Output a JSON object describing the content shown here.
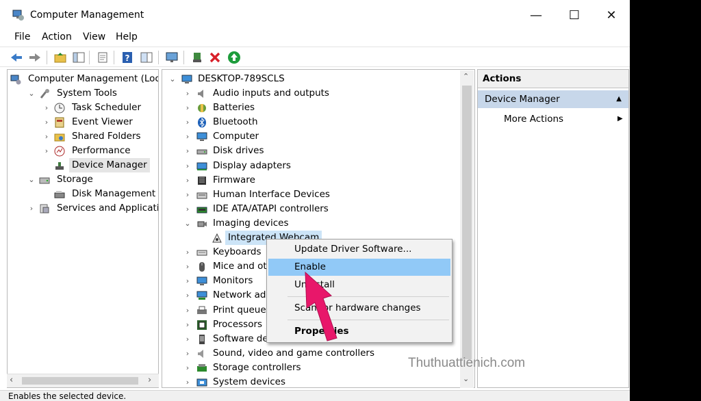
{
  "window": {
    "title": "Computer Management"
  },
  "menu": [
    "File",
    "Action",
    "View",
    "Help"
  ],
  "left_tree": [
    {
      "label": "Computer Management (Local",
      "indent": 0,
      "chev": "",
      "icon": "computer-management-icon"
    },
    {
      "label": "System Tools",
      "indent": 1,
      "chev": "down",
      "icon": "system-tools-icon"
    },
    {
      "label": "Task Scheduler",
      "indent": 2,
      "chev": "right",
      "icon": "clock-icon"
    },
    {
      "label": "Event Viewer",
      "indent": 2,
      "chev": "right",
      "icon": "event-viewer-icon"
    },
    {
      "label": "Shared Folders",
      "indent": 2,
      "chev": "right",
      "icon": "shared-folder-icon"
    },
    {
      "label": "Performance",
      "indent": 2,
      "chev": "right",
      "icon": "performance-icon"
    },
    {
      "label": "Device Manager",
      "indent": 2,
      "chev": "",
      "icon": "device-manager-icon",
      "selected": true
    },
    {
      "label": "Storage",
      "indent": 1,
      "chev": "down",
      "icon": "storage-icon"
    },
    {
      "label": "Disk Management",
      "indent": 2,
      "chev": "",
      "icon": "disk-icon"
    },
    {
      "label": "Services and Applications",
      "indent": 1,
      "chev": "right",
      "icon": "services-icon"
    }
  ],
  "device_tree": {
    "root": "DESKTOP-789SCLS",
    "items": [
      {
        "label": "Audio inputs and outputs",
        "icon": "speaker-icon",
        "chev": "right"
      },
      {
        "label": "Batteries",
        "icon": "battery-icon",
        "chev": "right"
      },
      {
        "label": "Bluetooth",
        "icon": "bluetooth-icon",
        "chev": "right"
      },
      {
        "label": "Computer",
        "icon": "monitor-icon",
        "chev": "right"
      },
      {
        "label": "Disk drives",
        "icon": "disk-drive-icon",
        "chev": "right"
      },
      {
        "label": "Display adapters",
        "icon": "display-adapter-icon",
        "chev": "right"
      },
      {
        "label": "Firmware",
        "icon": "firmware-icon",
        "chev": "right"
      },
      {
        "label": "Human Interface Devices",
        "icon": "hid-icon",
        "chev": "right"
      },
      {
        "label": "IDE ATA/ATAPI controllers",
        "icon": "ide-icon",
        "chev": "right"
      },
      {
        "label": "Imaging devices",
        "icon": "camera-icon",
        "chev": "down"
      },
      {
        "label": "Integrated Webcam",
        "icon": "webcam-icon",
        "chev": "",
        "child": true,
        "selected": true
      },
      {
        "label": "Keyboards",
        "icon": "keyboard-icon",
        "chev": "right"
      },
      {
        "label": "Mice and oth",
        "icon": "mouse-icon",
        "chev": "right"
      },
      {
        "label": "Monitors",
        "icon": "monitor-icon",
        "chev": "right"
      },
      {
        "label": "Network ada",
        "icon": "network-icon",
        "chev": "right"
      },
      {
        "label": "Print queues",
        "icon": "printer-icon",
        "chev": "right"
      },
      {
        "label": "Processors",
        "icon": "processor-icon",
        "chev": "right"
      },
      {
        "label": "Software dev",
        "icon": "software-device-icon",
        "chev": "right"
      },
      {
        "label": "Sound, video and game controllers",
        "icon": "sound-icon",
        "chev": "right"
      },
      {
        "label": "Storage controllers",
        "icon": "storage-controller-icon",
        "chev": "right"
      },
      {
        "label": "System devices",
        "icon": "system-device-icon",
        "chev": "right"
      }
    ]
  },
  "context_menu": {
    "update": "Update Driver Software...",
    "enable": "Enable",
    "uninstall": "Uninstall",
    "scan": "Scan for hardware changes",
    "properties": "Properties"
  },
  "actions": {
    "header": "Actions",
    "section": "Device Manager",
    "more": "More Actions"
  },
  "status": "Enables the selected device.",
  "watermark": "Thuthuattienich.com",
  "colors": {
    "menu_hover": "#91c9f7",
    "actions_section": "#c7d7ea",
    "arrow": "#e8176a"
  }
}
